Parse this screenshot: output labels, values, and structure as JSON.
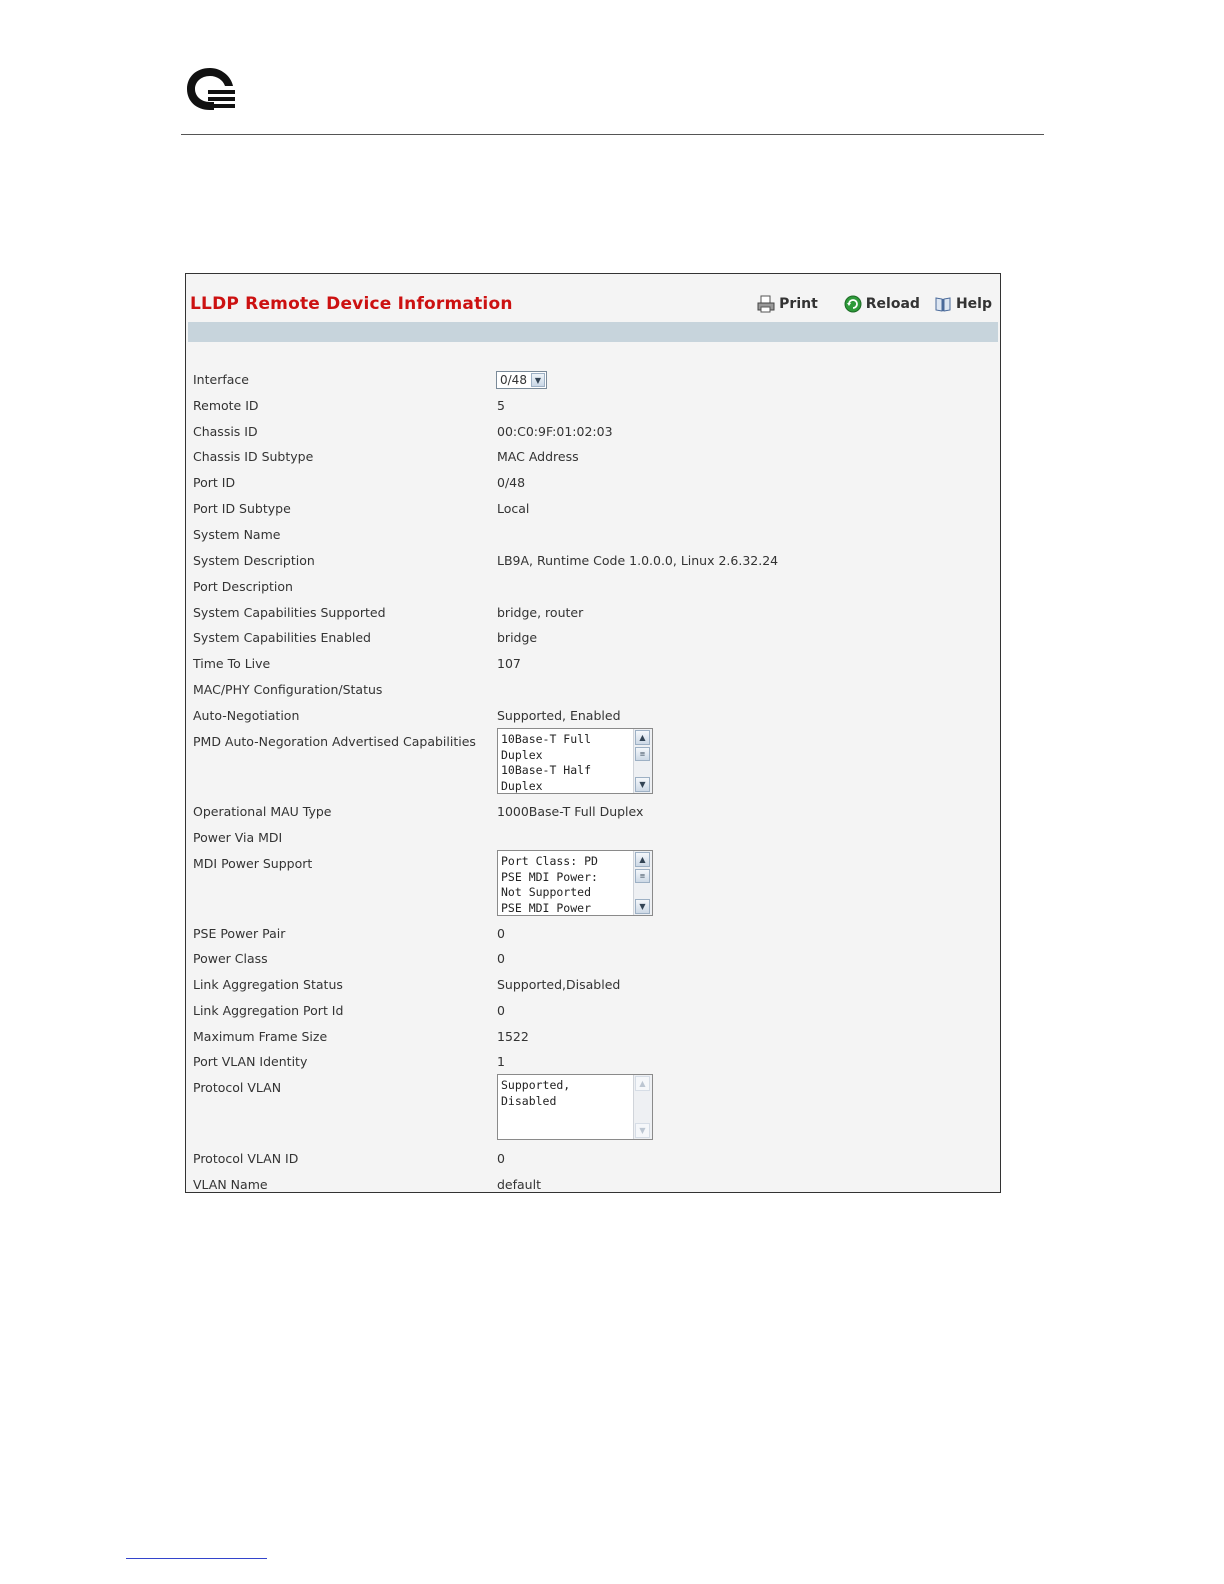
{
  "page": {
    "title": "LLDP Remote Device Information",
    "toolbar": {
      "print": "Print",
      "reload": "Reload",
      "help": "Help"
    }
  },
  "fields": {
    "interface": {
      "label": "Interface",
      "value": "0/48"
    },
    "remote_id": {
      "label": "Remote ID",
      "value": "5"
    },
    "chassis_id": {
      "label": "Chassis ID",
      "value": "00:C0:9F:01:02:03"
    },
    "chassis_id_subtype": {
      "label": "Chassis ID Subtype",
      "value": "MAC Address"
    },
    "port_id": {
      "label": "Port ID",
      "value": "0/48"
    },
    "port_id_subtype": {
      "label": "Port ID Subtype",
      "value": "Local"
    },
    "system_name": {
      "label": "System Name",
      "value": ""
    },
    "system_description": {
      "label": "System Description",
      "value": "LB9A, Runtime Code 1.0.0.0, Linux 2.6.32.24"
    },
    "port_description": {
      "label": "Port Description",
      "value": ""
    },
    "sys_cap_supported": {
      "label": "System Capabilities Supported",
      "value": "bridge, router"
    },
    "sys_cap_enabled": {
      "label": "System Capabilities Enabled",
      "value": "bridge"
    },
    "ttl": {
      "label": "Time To Live",
      "value": "107"
    },
    "mac_phy": {
      "label": "MAC/PHY Configuration/Status",
      "value": ""
    },
    "auto_neg": {
      "label": "Auto-Negotiation",
      "value": "Supported, Enabled"
    },
    "pmd_caps": {
      "label": "PMD Auto-Negoration Advertised Capabilities",
      "value": "10Base-T Full Duplex\n10Base-T Half Duplex"
    },
    "mau_type": {
      "label": "Operational MAU Type",
      "value": "1000Base-T Full Duplex"
    },
    "power_via_mdi": {
      "label": "Power Via MDI",
      "value": ""
    },
    "mdi_power_support": {
      "label": "MDI Power Support",
      "value": "Port Class: PD\nPSE MDI Power:\nNot Supported\nPSE MDI Power"
    },
    "pse_power_pair": {
      "label": "PSE Power Pair",
      "value": "0"
    },
    "power_class": {
      "label": "Power Class",
      "value": "0"
    },
    "link_agg_status": {
      "label": "Link Aggregation Status",
      "value": "Supported,Disabled"
    },
    "link_agg_port_id": {
      "label": "Link Aggregation Port Id",
      "value": "0"
    },
    "max_frame_size": {
      "label": "Maximum Frame Size",
      "value": "1522"
    },
    "port_vlan_identity": {
      "label": "Port VLAN Identity",
      "value": "1"
    },
    "protocol_vlan": {
      "label": "Protocol VLAN",
      "value": "Supported,\nDisabled"
    },
    "protocol_vlan_id": {
      "label": "Protocol VLAN ID",
      "value": "0"
    },
    "vlan_name": {
      "label": "VLAN Name",
      "value": "default"
    }
  },
  "icons": {
    "logo": "company-logo",
    "print": "printer-icon",
    "reload": "reload-icon",
    "help": "help-book-icon"
  },
  "colors": {
    "title": "#cc1111",
    "band": "#c7d4dc",
    "panel": "#f4f4f4"
  }
}
